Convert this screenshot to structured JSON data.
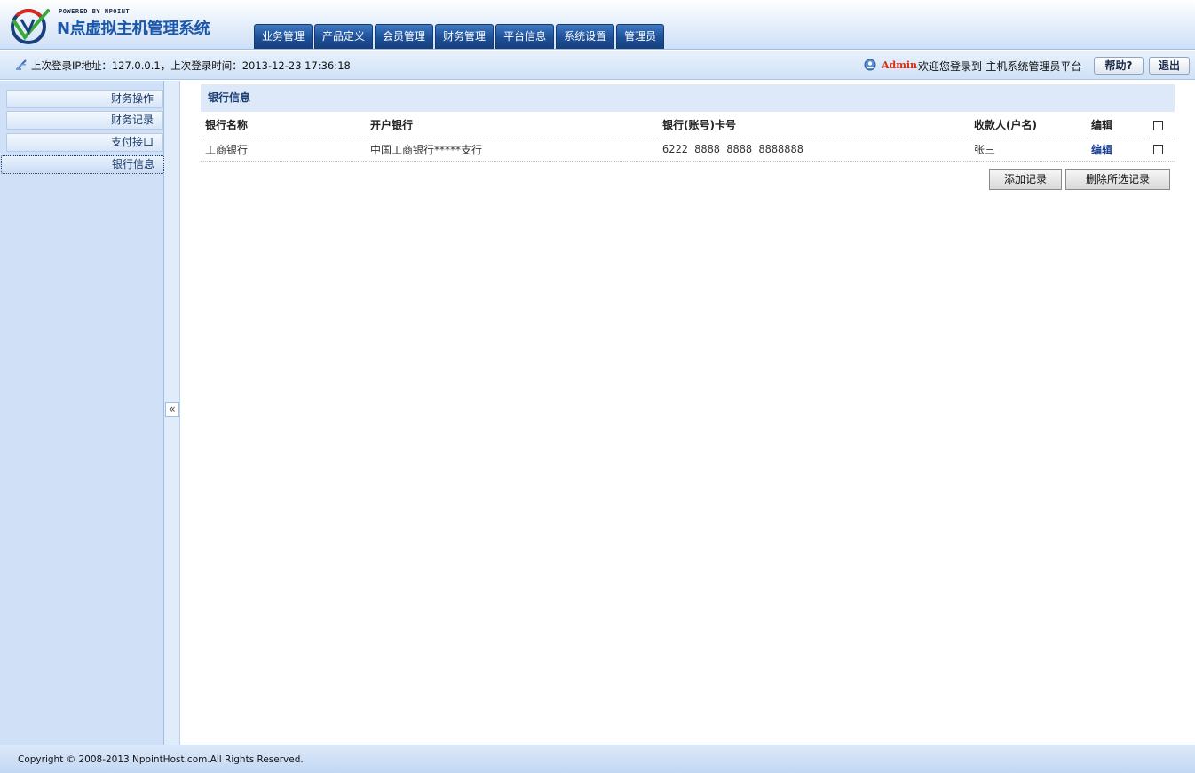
{
  "header": {
    "logo_powered": "POWERED BY NPOINT",
    "logo_title": "N点虚拟主机管理系统",
    "nav": [
      "业务管理",
      "产品定义",
      "会员管理",
      "财务管理",
      "平台信息",
      "系统设置",
      "管理员"
    ]
  },
  "infobar": {
    "login_info": "上次登录IP地址：127.0.0.1，上次登录时间：2013-12-23 17:36:18",
    "admin_name": "Admin",
    "welcome": "欢迎您登录到-主机系统管理员平台",
    "help_label": "帮助?",
    "logout_label": "退出"
  },
  "sidebar": {
    "items": [
      "财务操作",
      "财务记录",
      "支付接口",
      "银行信息"
    ],
    "active": "银行信息",
    "collapse_glyph": "«"
  },
  "main": {
    "title": "银行信息",
    "columns": [
      "银行名称",
      "开户银行",
      "银行(账号)卡号",
      "收款人(户名)",
      "编辑"
    ],
    "rows": [
      {
        "bank_name": "工商银行",
        "branch": "中国工商银行*****支行",
        "card_no": "6222 8888 8888 8888888",
        "payee": "张三",
        "edit": "编辑"
      }
    ],
    "add_label": "添加记录",
    "delete_label": "删除所选记录"
  },
  "footer": {
    "copyright": "Copyright © 2008-2013 NpointHost.com.All Rights Reserved."
  },
  "colors": {
    "nav_tab": "#1d4f97",
    "admin_name": "#e02c10",
    "sidebar_bg": "#cfe0f7",
    "panel_title_bg": "#dde9f8"
  }
}
